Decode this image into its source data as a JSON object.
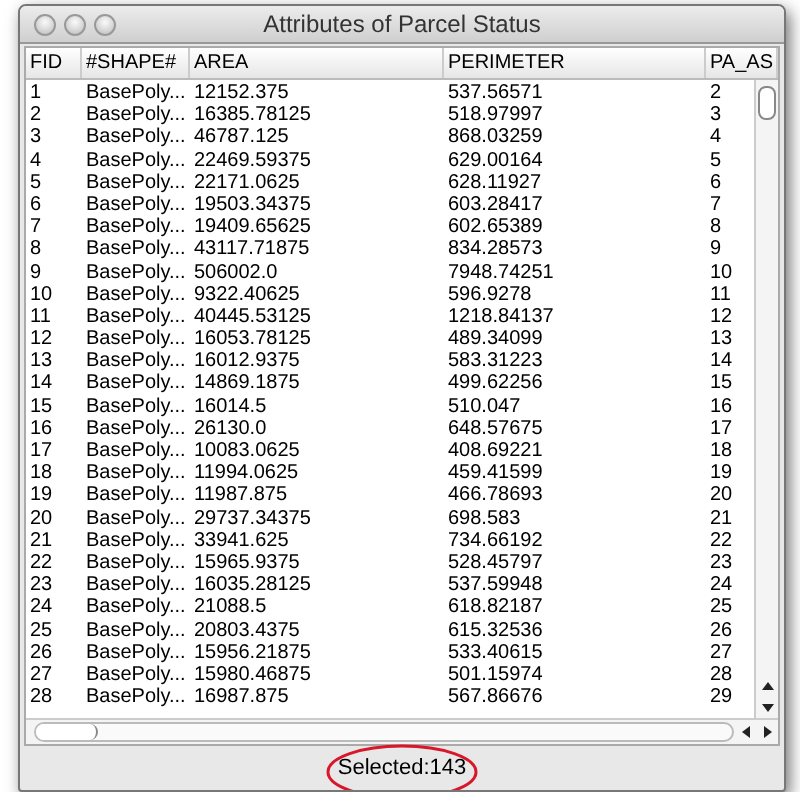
{
  "window": {
    "title": "Attributes of Parcel Status"
  },
  "table": {
    "columns": [
      "FID",
      "#SHAPE#",
      "AREA",
      "PERIMETER",
      "PA_AS"
    ],
    "rows": [
      [
        "1",
        "BasePoly...",
        "12152.375",
        "537.56571",
        "2"
      ],
      [
        "2",
        "BasePoly...",
        "16385.78125",
        "518.97997",
        "3"
      ],
      [
        "3",
        "BasePoly...",
        "46787.125",
        "868.03259",
        "4"
      ],
      [
        "4",
        "BasePoly...",
        "22469.59375",
        "629.00164",
        "5"
      ],
      [
        "5",
        "BasePoly...",
        "22171.0625",
        "628.11927",
        "6"
      ],
      [
        "6",
        "BasePoly...",
        "19503.34375",
        "603.28417",
        "7"
      ],
      [
        "7",
        "BasePoly...",
        "19409.65625",
        "602.65389",
        "8"
      ],
      [
        "8",
        "BasePoly...",
        "43117.71875",
        "834.28573",
        "9"
      ],
      [
        "9",
        "BasePoly...",
        "506002.0",
        "7948.74251",
        "10"
      ],
      [
        "10",
        "BasePoly...",
        "9322.40625",
        "596.9278",
        "11"
      ],
      [
        "11",
        "BasePoly...",
        "40445.53125",
        "1218.84137",
        "12"
      ],
      [
        "12",
        "BasePoly...",
        "16053.78125",
        "489.34099",
        "13"
      ],
      [
        "13",
        "BasePoly...",
        "16012.9375",
        "583.31223",
        "14"
      ],
      [
        "14",
        "BasePoly...",
        "14869.1875",
        "499.62256",
        "15"
      ],
      [
        "15",
        "BasePoly...",
        "16014.5",
        "510.047",
        "16"
      ],
      [
        "16",
        "BasePoly...",
        "26130.0",
        "648.57675",
        "17"
      ],
      [
        "17",
        "BasePoly...",
        "10083.0625",
        "408.69221",
        "18"
      ],
      [
        "18",
        "BasePoly...",
        "11994.0625",
        "459.41599",
        "19"
      ],
      [
        "19",
        "BasePoly...",
        "11987.875",
        "466.78693",
        "20"
      ],
      [
        "20",
        "BasePoly...",
        "29737.34375",
        "698.583",
        "21"
      ],
      [
        "21",
        "BasePoly...",
        "33941.625",
        "734.66192",
        "22"
      ],
      [
        "22",
        "BasePoly...",
        "15965.9375",
        "528.45797",
        "23"
      ],
      [
        "23",
        "BasePoly...",
        "16035.28125",
        "537.59948",
        "24"
      ],
      [
        "24",
        "BasePoly...",
        "21088.5",
        "618.82187",
        "25"
      ],
      [
        "25",
        "BasePoly...",
        "20803.4375",
        "615.32536",
        "26"
      ],
      [
        "26",
        "BasePoly...",
        "15956.21875",
        "533.40615",
        "27"
      ],
      [
        "27",
        "BasePoly...",
        "15980.46875",
        "501.15974",
        "28"
      ],
      [
        "28",
        "BasePoly...",
        "16987.875",
        "567.86676",
        "29"
      ]
    ]
  },
  "status_bar": {
    "text": "Selected:143",
    "circled": true
  }
}
